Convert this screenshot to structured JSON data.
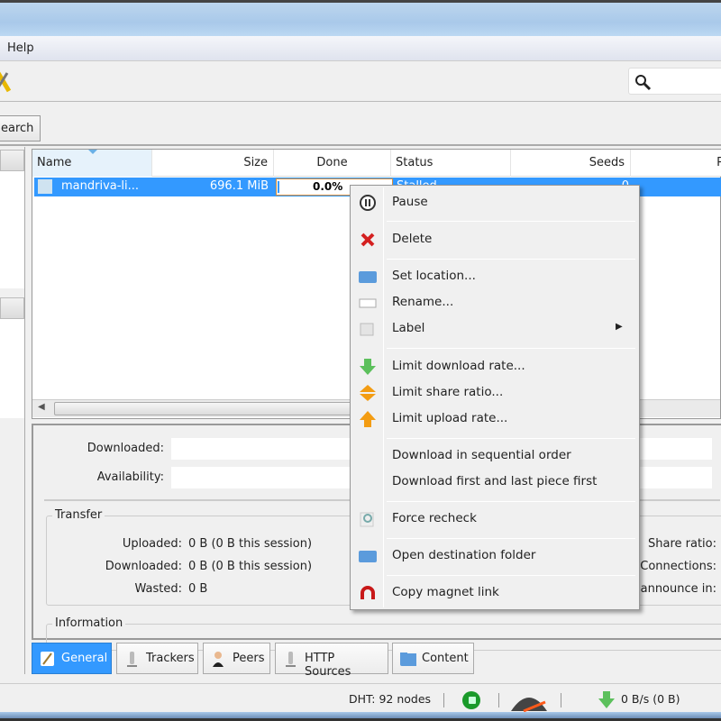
{
  "menubar": {
    "help": "Help"
  },
  "tabs": {
    "search": "earch"
  },
  "table": {
    "columns": [
      "Name",
      "Size",
      "Done",
      "Status",
      "Seeds",
      "P"
    ],
    "rows": [
      {
        "name": "mandriva-li...",
        "size": "696.1 MiB",
        "done": "0.0%",
        "progress": 0,
        "status": "Stalled",
        "seeds": "0"
      }
    ]
  },
  "details": {
    "downloaded_label": "Downloaded:",
    "availability_label": "Availability:",
    "transfer": {
      "title": "Transfer",
      "uploaded_label": "Uploaded:",
      "uploaded": "0 B (0 B this session)",
      "downloaded_label": "Downloaded:",
      "downloaded": "0 B (0 B this session)",
      "wasted_label": "Wasted:",
      "wasted": "0 B",
      "share_ratio_label": "Share ratio:",
      "connections_label": "Connections:",
      "announce_label": "announce in:"
    },
    "information_title": "Information"
  },
  "bottom_tabs": [
    "General",
    "Trackers",
    "Peers",
    "HTTP Sources",
    "Content"
  ],
  "status": {
    "dht": "DHT: 92 nodes",
    "download": "0 B/s (0 B)"
  },
  "context_menu": [
    {
      "label": "Pause",
      "icon": "pause-icon"
    },
    {
      "label": "Delete",
      "icon": "delete-icon"
    },
    {
      "label": "Set location...",
      "icon": "folder-icon"
    },
    {
      "label": "Rename...",
      "icon": "rename-icon"
    },
    {
      "label": "Label",
      "icon": "label-icon"
    },
    {
      "label": "Limit download rate...",
      "icon": "download-arrow-icon"
    },
    {
      "label": "Limit share ratio...",
      "icon": "share-ratio-icon"
    },
    {
      "label": "Limit upload rate...",
      "icon": "upload-arrow-icon"
    },
    {
      "label": "Download in sequential order",
      "icon": ""
    },
    {
      "label": "Download first and last piece first",
      "icon": ""
    },
    {
      "label": "Force recheck",
      "icon": "recheck-icon"
    },
    {
      "label": "Open destination folder",
      "icon": "folder-icon"
    },
    {
      "label": "Copy magnet link",
      "icon": "magnet-icon"
    }
  ],
  "colors": {
    "selection": "#3399ff",
    "accent_orange": "#f39c12",
    "green": "#5cb85c"
  }
}
